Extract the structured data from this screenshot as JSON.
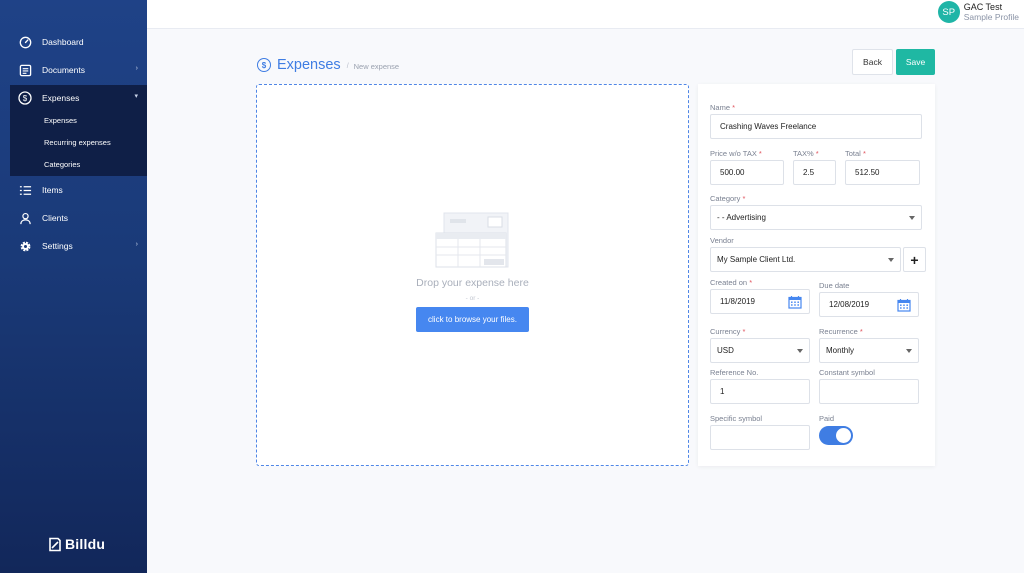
{
  "sidebar": {
    "items": [
      {
        "label": "Dashboard",
        "icon": "speedometer-icon"
      },
      {
        "label": "Documents",
        "icon": "document-icon"
      },
      {
        "label": "Expenses",
        "icon": "dollar-circle-icon"
      },
      {
        "label": "Items",
        "icon": "list-icon"
      },
      {
        "label": "Clients",
        "icon": "user-icon"
      },
      {
        "label": "Settings",
        "icon": "gear-icon"
      }
    ],
    "submenu": [
      "Expenses",
      "Recurring expenses",
      "Categories"
    ],
    "logo": "Billdu"
  },
  "profile": {
    "initials": "SP",
    "name": "GAC Test",
    "subtitle": "Sample Profile"
  },
  "header": {
    "title": "Expenses",
    "separator": "/",
    "breadcrumb": "New expense",
    "back_label": "Back",
    "save_label": "Save"
  },
  "dropzone": {
    "title": "Drop your expense here",
    "or": "- or -",
    "browse_label": "click to browse your files."
  },
  "form": {
    "name": {
      "label": "Name",
      "required": "*",
      "value": "Crashing Waves Freelance"
    },
    "price": {
      "label": "Price w/o TAX",
      "required": "*",
      "value": "500.00"
    },
    "tax": {
      "label": "TAX%",
      "required": "*",
      "value": "2.5"
    },
    "total": {
      "label": "Total",
      "required": "*",
      "value": "512.50"
    },
    "category": {
      "label": "Category",
      "required": "*",
      "value": "- - Advertising"
    },
    "vendor": {
      "label": "Vendor",
      "value": "My Sample Client Ltd.",
      "add_label": "+"
    },
    "created_on": {
      "label": "Created on",
      "required": "*",
      "value": "11/8/2019"
    },
    "due_date": {
      "label": "Due date",
      "value": "12/08/2019"
    },
    "currency": {
      "label": "Currency",
      "required": "*",
      "value": "USD"
    },
    "recurrence": {
      "label": "Recurrence",
      "required": "*",
      "value": "Monthly"
    },
    "reference": {
      "label": "Reference No.",
      "value": "1"
    },
    "constant_symbol": {
      "label": "Constant symbol",
      "value": ""
    },
    "specific_symbol": {
      "label": "Specific symbol",
      "value": ""
    },
    "paid": {
      "label": "Paid",
      "checked": true
    }
  },
  "colors": {
    "accent": "#3f7de3",
    "save": "#1fb8a3",
    "sidebar": "#1f4287",
    "required": "#e0535d"
  }
}
